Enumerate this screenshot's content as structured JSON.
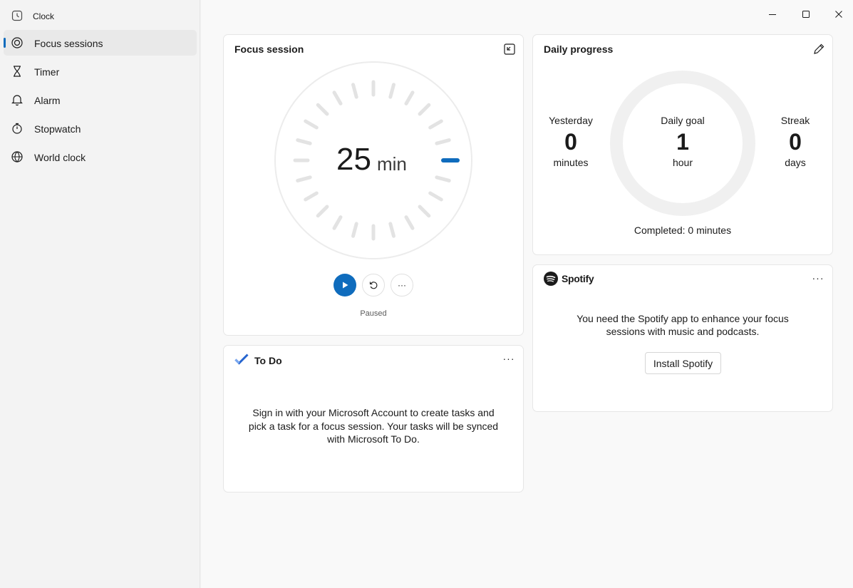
{
  "window": {
    "title": "Clock"
  },
  "sidebar": {
    "items": [
      {
        "label": "Focus sessions",
        "icon": "focus-icon",
        "active": true
      },
      {
        "label": "Timer",
        "icon": "hourglass-icon",
        "active": false
      },
      {
        "label": "Alarm",
        "icon": "bell-icon",
        "active": false
      },
      {
        "label": "Stopwatch",
        "icon": "stopwatch-icon",
        "active": false
      },
      {
        "label": "World clock",
        "icon": "globe-icon",
        "active": false
      }
    ]
  },
  "focus_session": {
    "title": "Focus session",
    "duration_value": "25",
    "duration_unit": "min",
    "status": "Paused",
    "more_label": "···"
  },
  "daily_progress": {
    "title": "Daily progress",
    "yesterday": {
      "label": "Yesterday",
      "value": "0",
      "unit": "minutes"
    },
    "daily_goal": {
      "label": "Daily goal",
      "value": "1",
      "unit": "hour"
    },
    "streak": {
      "label": "Streak",
      "value": "0",
      "unit": "days"
    },
    "completed": "Completed: 0 minutes"
  },
  "todo": {
    "title": "To Do",
    "more_label": "···",
    "message": "Sign in with your Microsoft Account to create tasks and pick a task for a focus session. Your tasks will be synced with Microsoft To Do."
  },
  "spotify": {
    "title": "Spotify",
    "more_label": "···",
    "message": "You need the Spotify app to enhance your focus sessions with music and podcasts.",
    "install_label": "Install Spotify"
  },
  "colors": {
    "accent": "#0f6cbd",
    "spotify": "#1b1b1b"
  }
}
